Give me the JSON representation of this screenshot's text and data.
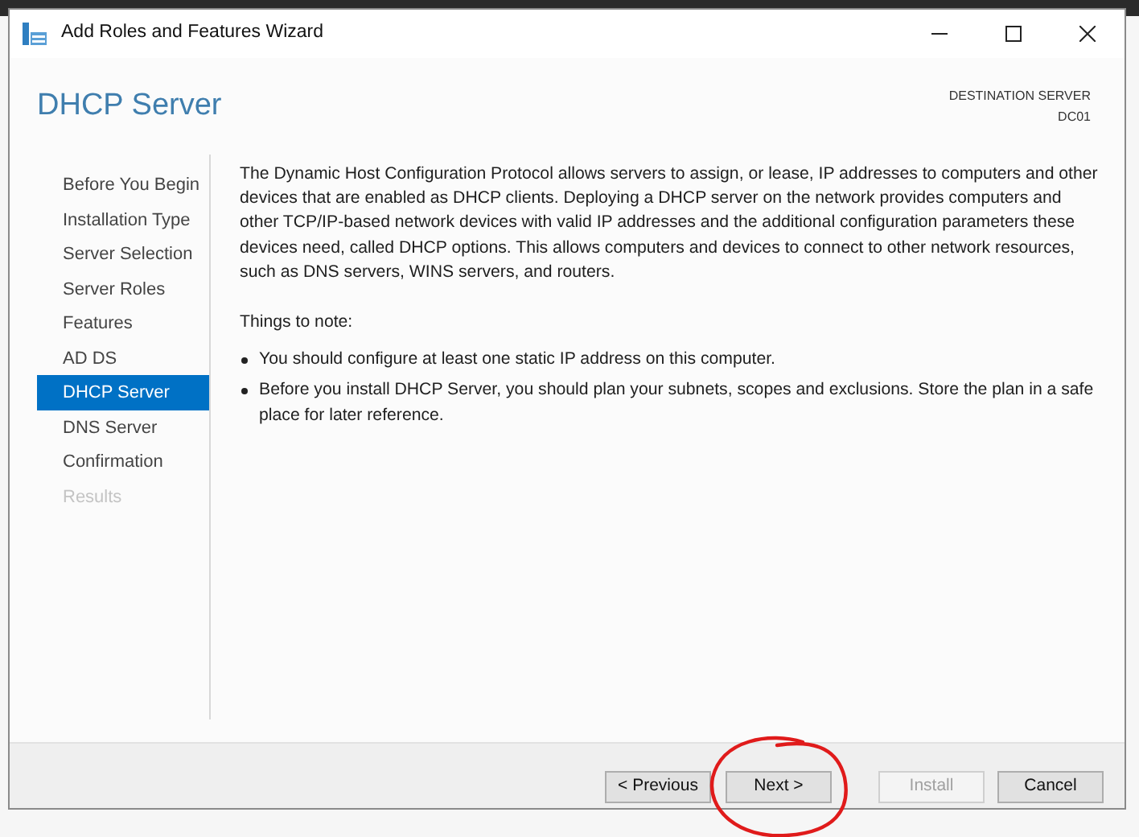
{
  "window": {
    "title": "Add Roles and Features Wizard"
  },
  "header": {
    "title": "DHCP Server",
    "destination_label": "DESTINATION SERVER",
    "destination_server": "DC01"
  },
  "steps": [
    {
      "label": "Before You Begin",
      "selected": false,
      "disabled": false
    },
    {
      "label": "Installation Type",
      "selected": false,
      "disabled": false
    },
    {
      "label": "Server Selection",
      "selected": false,
      "disabled": false
    },
    {
      "label": "Server Roles",
      "selected": false,
      "disabled": false
    },
    {
      "label": "Features",
      "selected": false,
      "disabled": false
    },
    {
      "label": "AD DS",
      "selected": false,
      "disabled": false
    },
    {
      "label": "DHCP Server",
      "selected": true,
      "disabled": false
    },
    {
      "label": "DNS Server",
      "selected": false,
      "disabled": false
    },
    {
      "label": "Confirmation",
      "selected": false,
      "disabled": false
    },
    {
      "label": "Results",
      "selected": false,
      "disabled": true
    }
  ],
  "content": {
    "description": "The Dynamic Host Configuration Protocol allows servers to assign, or lease, IP addresses to computers and other devices that are enabled as DHCP clients. Deploying a DHCP server on the network provides computers and other TCP/IP-based network devices with valid IP addresses and the additional configuration parameters these devices need, called DHCP options. This allows computers and devices to connect to other network resources, such as DNS servers, WINS servers, and routers.",
    "note_heading": "Things to note:",
    "notes": [
      "You should configure at least one static IP address on this computer.",
      "Before you install DHCP Server, you should plan your subnets, scopes and exclusions. Store the plan in a safe place for later reference."
    ]
  },
  "buttons": [
    {
      "label": "< Previous",
      "disabled": false,
      "circled": false
    },
    {
      "label": "Next >",
      "disabled": false,
      "circled": true
    },
    {
      "label": "Install",
      "disabled": true,
      "circled": false
    },
    {
      "label": "Cancel",
      "disabled": false,
      "circled": false
    }
  ]
}
